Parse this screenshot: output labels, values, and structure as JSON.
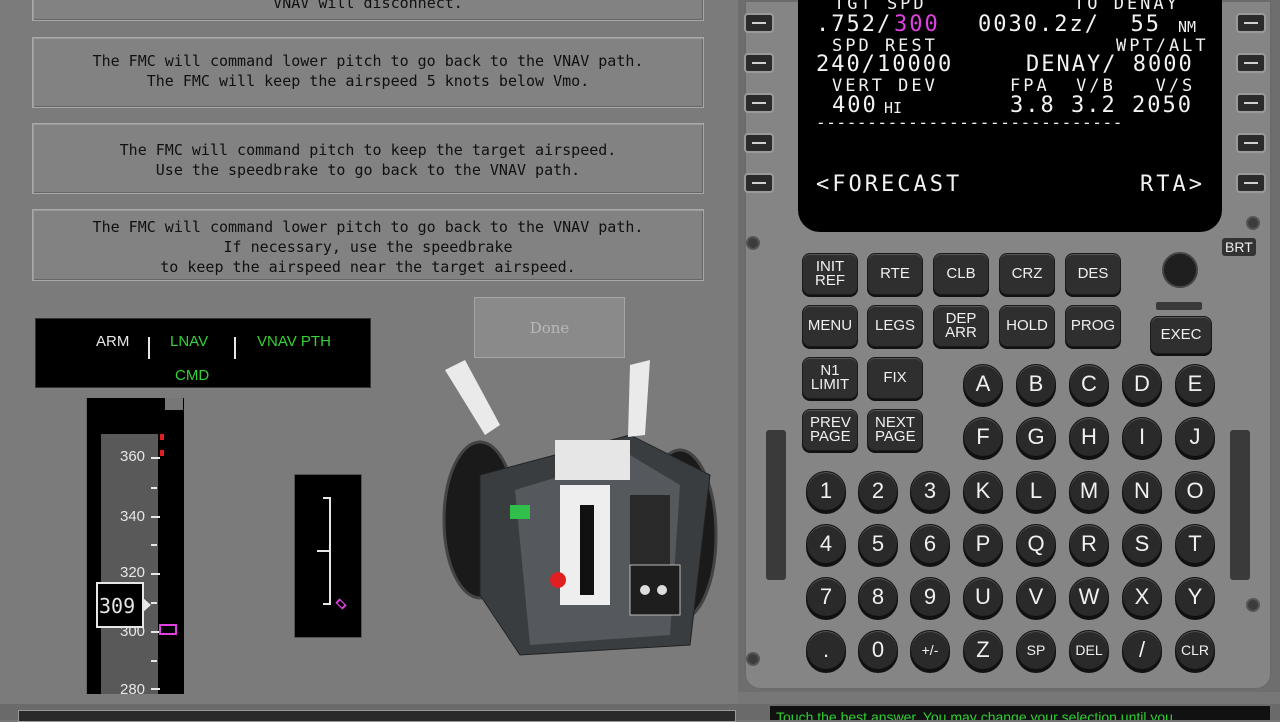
{
  "answers": [
    {
      "lines": [
        "VNAV will disconnect."
      ]
    },
    {
      "lines": [
        "The FMC will command lower pitch to go back to the VNAV path.",
        "The FMC will keep the airspeed 5 knots below Vmo."
      ]
    },
    {
      "lines": [
        "The FMC will command pitch to keep the target airspeed.",
        "Use the speedbrake to go back to the VNAV path."
      ]
    },
    {
      "lines": [
        "The FMC will command lower pitch to go back to the VNAV path.",
        "If necessary, use the speedbrake",
        "to keep the airspeed near the target airspeed."
      ]
    }
  ],
  "done_label": "Done",
  "fma": {
    "arm": "ARM",
    "lnav": "LNAV",
    "vnav": "VNAV PTH",
    "cmd": "CMD"
  },
  "speed_tape": {
    "labels": [
      "360",
      "340",
      "320",
      "300",
      "280"
    ],
    "current": "309",
    "current_value": 309,
    "target_value": 300
  },
  "cdu": {
    "line1": {
      "left": "TGT SPD",
      "right": "TO DENAY"
    },
    "line1_data": {
      "mach": ".752/",
      "spd": "300",
      "right": "0030.2z/  55",
      "unit": "NM"
    },
    "line2": {
      "left": "SPD REST",
      "right": "WPT/ALT"
    },
    "line2_data": {
      "left": "240/10000",
      "right": "DENAY/ 8000"
    },
    "line3": {
      "left": "VERT DEV",
      "right": "FPA  V/B   V/S"
    },
    "line3_data": {
      "left": "400",
      "hi": "HI",
      "right": "3.8 3.2 2050"
    },
    "dashes": "------------------------------",
    "forecast": "<FORECAST",
    "rta": "RTA>",
    "brt": "BRT",
    "function_keys": [
      "INIT REF",
      "RTE",
      "CLB",
      "CRZ",
      "DES",
      "MENU",
      "LEGS",
      "DEP ARR",
      "HOLD",
      "PROG",
      "N1 LIMIT",
      "FIX",
      "PREV PAGE",
      "NEXT PAGE"
    ],
    "exec": "EXEC",
    "letters": [
      "A",
      "B",
      "C",
      "D",
      "E",
      "F",
      "G",
      "H",
      "I",
      "J",
      "K",
      "L",
      "M",
      "N",
      "O",
      "P",
      "Q",
      "R",
      "S",
      "T",
      "U",
      "V",
      "W",
      "X",
      "Y",
      "Z",
      "SP",
      "DEL",
      "/",
      "CLR"
    ],
    "numbers": [
      "1",
      "2",
      "3",
      "4",
      "5",
      "6",
      "7",
      "8",
      "9",
      ".",
      "0",
      "+/-"
    ],
    "colors": {
      "magenta": "#e040e0",
      "green": "#34d234"
    }
  },
  "prompt": "Touch the best answer. You may change your selection until you"
}
